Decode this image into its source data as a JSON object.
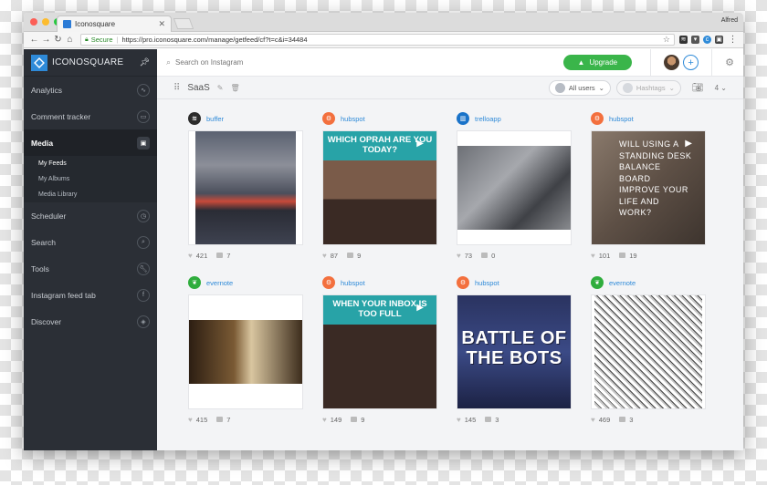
{
  "browser": {
    "tab_title": "Iconosquare",
    "profile_name": "Alfred",
    "secure_label": "Secure",
    "url": "https://pro.iconosquare.com/manage/getfeed/cf?t=c&i=34484",
    "traffic_lights": [
      "#fc5f57",
      "#fdbc2e",
      "#28c840"
    ]
  },
  "sidebar": {
    "brand": "ICONOSQUARE",
    "items": [
      {
        "label": "Analytics",
        "icon": "chart-icon"
      },
      {
        "label": "Comment tracker",
        "icon": "comment-icon"
      },
      {
        "label": "Media",
        "icon": "media-icon",
        "active": true
      },
      {
        "label": "Scheduler",
        "icon": "clock-icon"
      },
      {
        "label": "Search",
        "icon": "search-icon"
      },
      {
        "label": "Tools",
        "icon": "wrench-icon"
      },
      {
        "label": "Instagram feed tab",
        "icon": "facebook-icon"
      },
      {
        "label": "Discover",
        "icon": "compass-icon"
      }
    ],
    "subitems": [
      {
        "label": "My Feeds",
        "active": true
      },
      {
        "label": "My Albums"
      },
      {
        "label": "Media Library"
      }
    ]
  },
  "topbar": {
    "search_placeholder": "Search on Instagram",
    "upgrade_label": "Upgrade"
  },
  "feedbar": {
    "feed_name": "SaaS",
    "users_filter": "All users",
    "hashtags_filter": "Hashtags",
    "count": "4"
  },
  "colors": {
    "accent": "#2e8ad8",
    "upgrade": "#3ab54a",
    "sidebar": "#2b2f36"
  },
  "posts": [
    {
      "account": "buffer",
      "likes": "421",
      "comments": "7",
      "icon_color": "#2b2b2b",
      "icon_glyph": "≋"
    },
    {
      "account": "hubspot",
      "likes": "87",
      "comments": "9",
      "icon_color": "#f3703e",
      "icon_glyph": "⚙",
      "headline": "WHICH OPRAH ARE YOU TODAY?"
    },
    {
      "account": "trelloapp",
      "likes": "73",
      "comments": "0",
      "icon_color": "#1a73c9",
      "icon_glyph": "▥"
    },
    {
      "account": "hubspot",
      "likes": "101",
      "comments": "19",
      "icon_color": "#f3703e",
      "icon_glyph": "⚙",
      "overlay": "WILL USING A STANDING DESK BALANCE BOARD IMPROVE YOUR LIFE AND WORK?"
    },
    {
      "account": "evernote",
      "likes": "415",
      "comments": "7",
      "icon_color": "#2fad3d",
      "icon_glyph": "❦"
    },
    {
      "account": "hubspot",
      "likes": "149",
      "comments": "9",
      "icon_color": "#f3703e",
      "icon_glyph": "⚙",
      "headline": "WHEN YOUR INBOX IS TOO FULL"
    },
    {
      "account": "hubspot",
      "likes": "145",
      "comments": "3",
      "icon_color": "#f3703e",
      "icon_glyph": "⚙",
      "overlay": "BATTLE OF THE BOTS"
    },
    {
      "account": "evernote",
      "likes": "469",
      "comments": "3",
      "icon_color": "#2fad3d",
      "icon_glyph": "❦"
    }
  ]
}
